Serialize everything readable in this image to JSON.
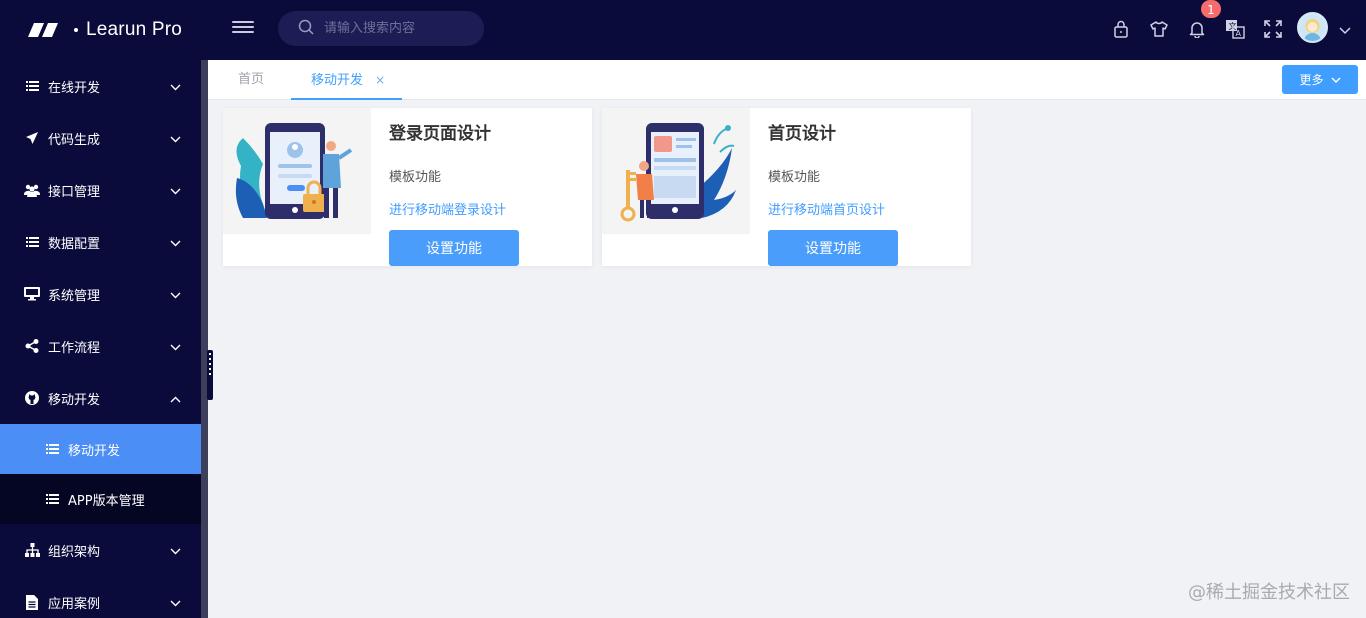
{
  "header": {
    "app_title": "Learun Pro",
    "search_placeholder": "请输入搜索内容",
    "notification_count": "1"
  },
  "sidebar": {
    "items": [
      {
        "label": "在线开发",
        "icon": "list-icon",
        "expanded": false
      },
      {
        "label": "代码生成",
        "icon": "paper-plane-icon",
        "expanded": false
      },
      {
        "label": "接口管理",
        "icon": "users-icon",
        "expanded": false
      },
      {
        "label": "数据配置",
        "icon": "list-icon",
        "expanded": false
      },
      {
        "label": "系统管理",
        "icon": "monitor-icon",
        "expanded": false
      },
      {
        "label": "工作流程",
        "icon": "share-icon",
        "expanded": false
      },
      {
        "label": "移动开发",
        "icon": "github-icon",
        "expanded": true
      },
      {
        "label": "组织架构",
        "icon": "sitemap-icon",
        "expanded": false
      },
      {
        "label": "应用案例",
        "icon": "document-icon",
        "expanded": false
      }
    ],
    "sub_items": [
      {
        "label": "移动开发",
        "active": true
      },
      {
        "label": "APP版本管理",
        "active": false
      }
    ]
  },
  "tabs": {
    "home": "首页",
    "active": "移动开发",
    "close_glyph": "×",
    "more_label": "更多"
  },
  "cards": [
    {
      "title": "登录页面设计",
      "subtitle": "模板功能",
      "link": "进行移动端登录设计",
      "button": "设置功能"
    },
    {
      "title": "首页设计",
      "subtitle": "模板功能",
      "link": "进行移动端首页设计",
      "button": "设置功能"
    }
  ],
  "watermark": "@稀土掘金技术社区",
  "colors": {
    "header_bg": "#0b0b3b",
    "accent": "#409eff",
    "active_nav": "#4b8ef5",
    "badge": "#f56c6c"
  }
}
